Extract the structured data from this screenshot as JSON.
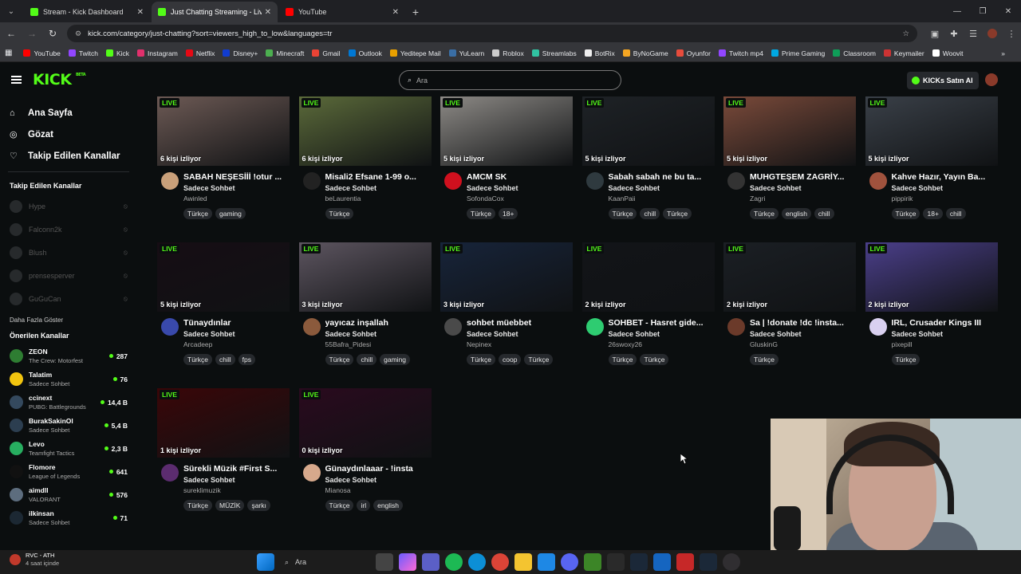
{
  "browser": {
    "tabs": [
      {
        "title": "Stream - Kick Dashboard",
        "color": "#53fc18",
        "active": false
      },
      {
        "title": "Just Chatting Streaming - Live S",
        "color": "#53fc18",
        "active": true
      },
      {
        "title": "YouTube",
        "color": "#ff0000",
        "active": false
      }
    ],
    "url": "kick.com/category/just-chatting?sort=viewers_high_to_low&languages=tr",
    "bookmarks": [
      {
        "label": "YouTube",
        "color": "#ff0000"
      },
      {
        "label": "Twitch",
        "color": "#9146ff"
      },
      {
        "label": "Kick",
        "color": "#53fc18"
      },
      {
        "label": "Instagram",
        "color": "#e1306c"
      },
      {
        "label": "Netflix",
        "color": "#e50914"
      },
      {
        "label": "Disney+",
        "color": "#113ccf"
      },
      {
        "label": "Minecraft",
        "color": "#4caf50"
      },
      {
        "label": "Gmail",
        "color": "#ea4335"
      },
      {
        "label": "Outlook",
        "color": "#0078d4"
      },
      {
        "label": "Yeditepe Mail",
        "color": "#e8a000"
      },
      {
        "label": "YuLearn",
        "color": "#3a6ea5"
      },
      {
        "label": "Roblox",
        "color": "#cccccc"
      },
      {
        "label": "Streamlabs",
        "color": "#31c3a2"
      },
      {
        "label": "BotRix",
        "color": "#eeeeee"
      },
      {
        "label": "ByNoGame",
        "color": "#f5a623"
      },
      {
        "label": "Oyunfor",
        "color": "#e74c3c"
      },
      {
        "label": "Twitch mp4",
        "color": "#9146ff"
      },
      {
        "label": "Prime Gaming",
        "color": "#00a8e1"
      },
      {
        "label": "Classroom",
        "color": "#0f9d58"
      },
      {
        "label": "Keymailer",
        "color": "#cc3333"
      },
      {
        "label": "Woovit",
        "color": "#ffffff"
      }
    ]
  },
  "header": {
    "logo": "KICK",
    "logo_sup": "BETA",
    "search_placeholder": "Ara",
    "kicks_button": "KICKs Satın Al"
  },
  "sidebar": {
    "nav": [
      {
        "label": "Ana Sayfa",
        "icon": "home-icon",
        "glyph": "⌂"
      },
      {
        "label": "Gözat",
        "icon": "compass-icon",
        "glyph": "◎"
      },
      {
        "label": "Takip Edilen Kanallar",
        "icon": "heart-icon",
        "glyph": "♡"
      }
    ],
    "followed_heading": "Takip Edilen Kanallar",
    "followed": [
      "Hype",
      "Falconn2k",
      "Blush",
      "prensesperver",
      "GuGuCan"
    ],
    "more_label": "Daha Fazla Göster",
    "recommended_heading": "Önerilen Kanallar",
    "recommended": [
      {
        "name": "ZEON",
        "category": "The Crew: Motorfest",
        "viewers": "287",
        "color": "#2e7d32"
      },
      {
        "name": "Talatim",
        "category": "Sadece Sohbet",
        "viewers": "76",
        "color": "#f1c40f"
      },
      {
        "name": "ccinext",
        "category": "PUBG: Battlegrounds",
        "viewers": "14,4 B",
        "color": "#34495e"
      },
      {
        "name": "BurakSakinOl",
        "category": "Sadece Sohbet",
        "viewers": "5,4 B",
        "color": "#2c3e50"
      },
      {
        "name": "Levo",
        "category": "Teamfight Tactics",
        "viewers": "2,3 B",
        "color": "#27ae60"
      },
      {
        "name": "Flomore",
        "category": "League of Legends",
        "viewers": "641",
        "color": "#111111"
      },
      {
        "name": "aimdll",
        "category": "VALORANT",
        "viewers": "576",
        "color": "#5d6d7e"
      },
      {
        "name": "ilkinsan",
        "category": "Sadece Sohbet",
        "viewers": "71",
        "color": "#1c2833"
      }
    ]
  },
  "cards": [
    {
      "title": "SABAH NEŞESİİİ !otur ...",
      "category": "Sadece Sohbet",
      "channel": "Awinled",
      "viewers": "6 kişi izliyor",
      "tags": [
        "Türkçe",
        "gaming"
      ],
      "thumb": "#6d5a55",
      "avatar": "#c9a07a"
    },
    {
      "title": "Misali2 Efsane 1-99 o...",
      "category": "Sadece Sohbet",
      "channel": "beLaurentia",
      "viewers": "6 kişi izliyor",
      "tags": [
        "Türkçe"
      ],
      "thumb": "#5b6a3a",
      "avatar": "#222222"
    },
    {
      "title": "AMCM SK",
      "category": "Sadece Sohbet",
      "channel": "SofondaCox",
      "viewers": "5 kişi izliyor",
      "tags": [
        "Türkçe",
        "18+"
      ],
      "thumb": "#8d8a86",
      "avatar": "#d0101e"
    },
    {
      "title": "Sabah sabah ne bu ta...",
      "category": "Sadece Sohbet",
      "channel": "KaanPaii",
      "viewers": "5 kişi izliyor",
      "tags": [
        "Türkçe",
        "chill",
        "Türkçe"
      ],
      "thumb": "#1e2226",
      "avatar": "#2f3a3f"
    },
    {
      "title": "MUHGTEŞEM ZAGRİY...",
      "category": "Sadece Sohbet",
      "channel": "Zagri",
      "viewers": "5 kişi izliyor",
      "tags": [
        "Türkçe",
        "english",
        "chill"
      ],
      "thumb": "#7a4a3a",
      "avatar": "#333333"
    },
    {
      "title": "Kahve Hazır, Yayın Ba...",
      "category": "Sadece Sohbet",
      "channel": "pippirik",
      "viewers": "5 kişi izliyor",
      "tags": [
        "Türkçe",
        "18+",
        "chill"
      ],
      "thumb": "#3a4048",
      "avatar": "#a0523d"
    },
    {
      "title": "Tünaydınlar",
      "category": "Sadece Sohbet",
      "channel": "Arcadeep",
      "viewers": "5 kişi izliyor",
      "tags": [
        "Türkçe",
        "chill",
        "fps"
      ],
      "thumb": "#160d14",
      "avatar": "#3949ab"
    },
    {
      "title": "yayıcaz inşallah",
      "category": "Sadece Sohbet",
      "channel": "55Bafra_Pidesi",
      "viewers": "3 kişi izliyor",
      "tags": [
        "Türkçe",
        "chill",
        "gaming"
      ],
      "thumb": "#5d5560",
      "avatar": "#8b5a3c"
    },
    {
      "title": "sohbet müebbet",
      "category": "Sadece Sohbet",
      "channel": "Nepinex",
      "viewers": "3 kişi izliyor",
      "tags": [
        "Türkçe",
        "coop",
        "Türkçe"
      ],
      "thumb": "#17243a",
      "avatar": "#4a4a4a"
    },
    {
      "title": "SOHBET - Hasret gide...",
      "category": "Sadece Sohbet",
      "channel": "26swoxy26",
      "viewers": "2 kişi izliyor",
      "tags": [
        "Türkçe",
        "Türkçe"
      ],
      "thumb": "#121418",
      "avatar": "#2ecc71"
    },
    {
      "title": "Sa | !donate !dc !insta...",
      "category": "Sadece Sohbet",
      "channel": "GluskinG",
      "viewers": "2 kişi izliyor",
      "tags": [
        "Türkçe"
      ],
      "thumb": "#1b1f24",
      "avatar": "#6b3a2a"
    },
    {
      "title": "IRL, Crusader Kings III",
      "category": "Sadece Sohbet",
      "channel": "pixepill",
      "viewers": "2 kişi izliyor",
      "tags": [
        "Türkçe"
      ],
      "thumb": "#4b3f8a",
      "avatar": "#d9d0f0"
    },
    {
      "title": "Sürekli Müzik #First S...",
      "category": "Sadece Sohbet",
      "channel": "sureklimuzik",
      "viewers": "1 kişi izliyor",
      "tags": [
        "Türkçe",
        "MÜZİK",
        "şarkı"
      ],
      "thumb": "#3a0608",
      "avatar": "#5b2c6f"
    },
    {
      "title": "Günaydınlaaar - !insta",
      "category": "Sadece Sohbet",
      "channel": "Mianosa",
      "viewers": "0 kişi izliyor",
      "tags": [
        "Türkçe",
        "irl",
        "english"
      ],
      "thumb": "#2a0a1e",
      "avatar": "#d7a98c"
    }
  ],
  "live_label": "LIVE",
  "taskbar": {
    "weather_title": "RVC - ATH",
    "weather_sub": "4 saat içinde",
    "search_label": "Ara"
  }
}
